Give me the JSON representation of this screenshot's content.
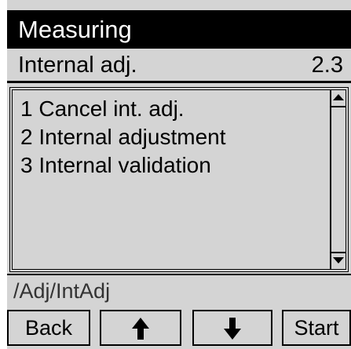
{
  "title": "Measuring",
  "parameter": {
    "label": "Internal adj.",
    "value": "2.3"
  },
  "menu_items": [
    "1 Cancel int. adj.",
    "2 Internal adjustment",
    "3 Internal validation"
  ],
  "path": "/Adj/IntAdj",
  "softkeys": {
    "back": "Back",
    "up_icon": "arrow-up",
    "down_icon": "arrow-down",
    "start": "Start"
  }
}
